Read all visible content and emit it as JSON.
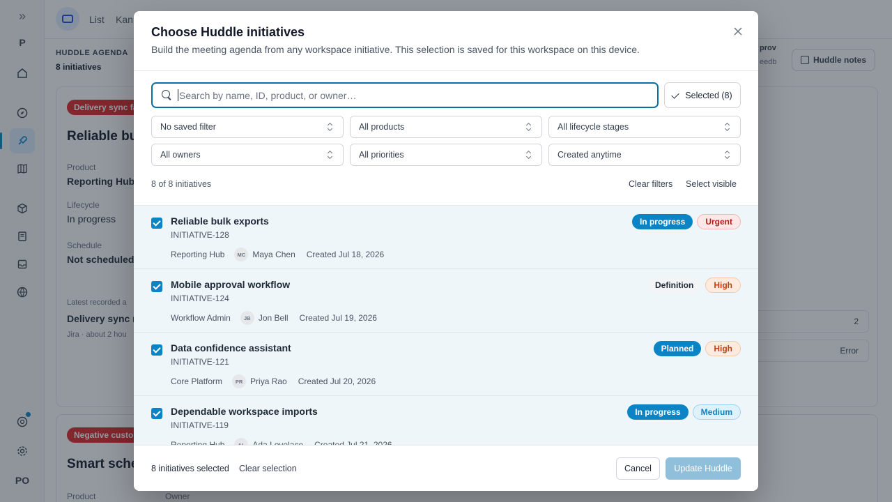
{
  "background": {
    "rail": {
      "expand_icon": "double-chevron-right-icon",
      "workspace_letter": "P",
      "user_initials": "PO"
    },
    "topbar": {
      "tabs": [
        "List",
        "Kan"
      ]
    },
    "agenda": {
      "label": "HUDDLE AGENDA",
      "count": "8 initiatives"
    },
    "card1": {
      "badge": "Delivery sync fa",
      "title": "Reliable bul",
      "product_label": "Product",
      "product_value": "Reporting Hub",
      "lifecycle_label": "Lifecycle",
      "lifecycle_value": "In progress",
      "schedule_label": "Schedule",
      "schedule_value": "Not scheduled",
      "latest_label": "Latest recorded a",
      "latest_value": "Delivery sync n",
      "latest_meta": "Jira · about 2 hou",
      "right_count": "2",
      "right_status": "Error"
    },
    "card2": {
      "badge": "Negative custo",
      "title": "Smart sched",
      "product_label": "Product",
      "owner_label": "Owner"
    },
    "huddle_notes": "Huddle notes",
    "approv_text": "prov",
    "eedb_text": "eedb"
  },
  "modal": {
    "title": "Choose Huddle initiatives",
    "subtitle": "Build the meeting agenda from any workspace initiative. This selection is saved for this workspace on this device.",
    "search_placeholder": "Search by name, ID, product, or owner…",
    "selected_button": "Selected (8)",
    "filters": {
      "saved_filter": "No saved filter",
      "products": "All products",
      "lifecycle": "All lifecycle stages",
      "owners": "All owners",
      "priorities": "All priorities",
      "created": "Created anytime"
    },
    "count_text": "8 of 8 initiatives",
    "clear_filters": "Clear filters",
    "select_visible": "Select visible",
    "initiatives": [
      {
        "title": "Reliable bulk exports",
        "id": "INITIATIVE-128",
        "product": "Reporting Hub",
        "owner_initials": "MC",
        "owner": "Maya Chen",
        "created": "Created Jul 18, 2026",
        "status": "In progress",
        "priority": "Urgent",
        "checked": true
      },
      {
        "title": "Mobile approval workflow",
        "id": "INITIATIVE-124",
        "product": "Workflow Admin",
        "owner_initials": "JB",
        "owner": "Jon Bell",
        "created": "Created Jul 19, 2026",
        "status": "Definition",
        "priority": "High",
        "checked": true
      },
      {
        "title": "Data confidence assistant",
        "id": "INITIATIVE-121",
        "product": "Core Platform",
        "owner_initials": "PR",
        "owner": "Priya Rao",
        "created": "Created Jul 20, 2026",
        "status": "Planned",
        "priority": "High",
        "checked": true
      },
      {
        "title": "Dependable workspace imports",
        "id": "INITIATIVE-119",
        "product": "Reporting Hub",
        "owner_initials": "AL",
        "owner": "Ada Lovelace",
        "created": "Created Jul 21, 2026",
        "status": "In progress",
        "priority": "Medium",
        "checked": true
      }
    ],
    "footer": {
      "selected_count": "8 initiatives selected",
      "clear_selection": "Clear selection",
      "cancel": "Cancel",
      "update": "Update Huddle"
    }
  },
  "colors": {
    "accent": "#0b84c6",
    "urgent": "#b91c1c",
    "high": "#c2410c",
    "medium": "#0b84c6",
    "update_button_disabled": "#8fbfda"
  }
}
